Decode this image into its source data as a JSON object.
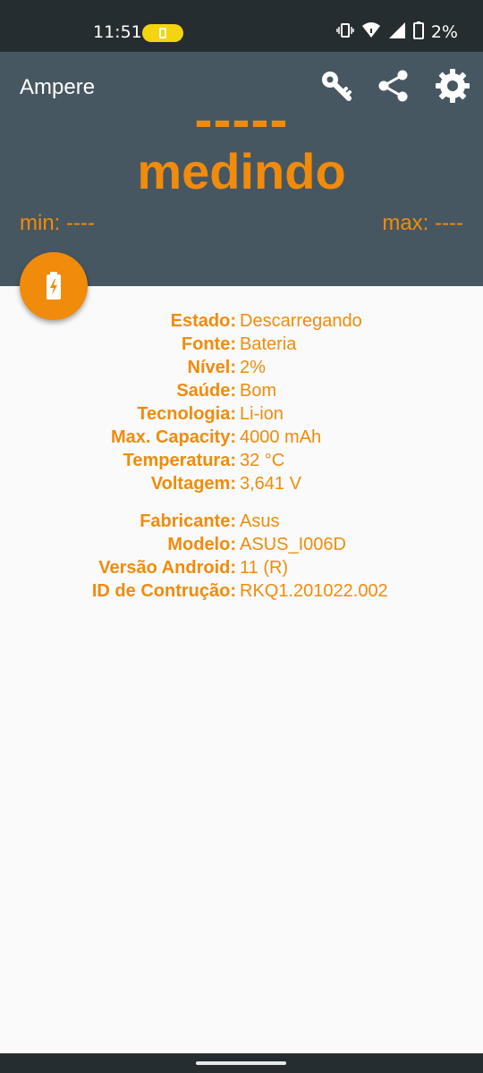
{
  "status_bar": {
    "time": "11:51",
    "battery_percent": "2%",
    "icons": [
      "vibrate-icon",
      "wifi-icon",
      "signal-icon",
      "battery-icon"
    ]
  },
  "app": {
    "title": "Ampere",
    "actions": [
      "key-icon",
      "share-icon",
      "gear-icon"
    ]
  },
  "reading": {
    "value": "-----",
    "status": "medindo",
    "min": "min: ----",
    "max": "max: ----"
  },
  "details": {
    "battery": [
      {
        "label": "Estado:",
        "value": "Descarregando"
      },
      {
        "label": "Fonte:",
        "value": "Bateria"
      },
      {
        "label": "Nível:",
        "value": "2%"
      },
      {
        "label": "Saúde:",
        "value": "Bom"
      },
      {
        "label": "Tecnologia:",
        "value": "Li-ion"
      },
      {
        "label": "Max. Capacity:",
        "value": "4000 mAh"
      },
      {
        "label": "Temperatura:",
        "value": "32 °C"
      },
      {
        "label": "Voltagem:",
        "value": "3,641 V"
      }
    ],
    "device": [
      {
        "label": "Fabricante:",
        "value": "Asus"
      },
      {
        "label": "Modelo:",
        "value": "ASUS_I006D"
      },
      {
        "label": "Versão Android:",
        "value": "11 (R)"
      },
      {
        "label": "ID de Contrução:",
        "value": "RKQ1.201022.002"
      }
    ]
  },
  "colors": {
    "accent": "#f18b0b",
    "toolbar": "#475761",
    "status_bar": "#252d31",
    "background": "#fafafa",
    "battery_saver": "#f4d40e"
  }
}
